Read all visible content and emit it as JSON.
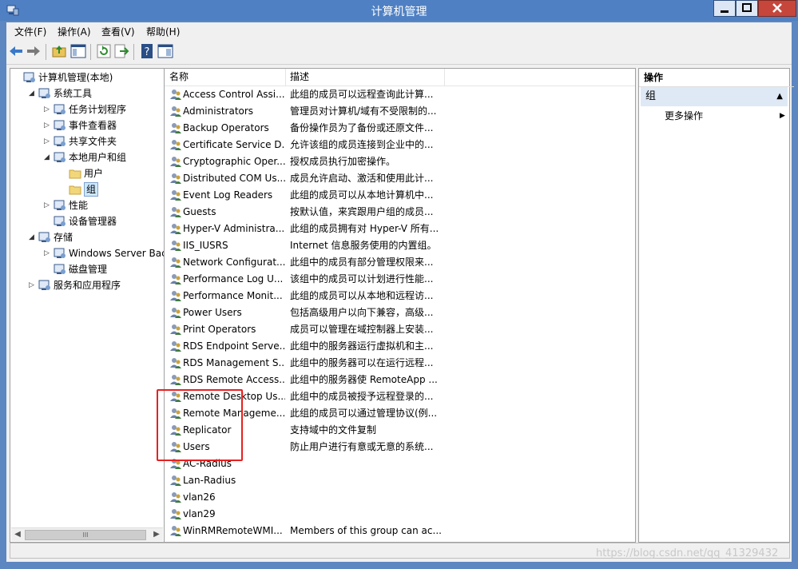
{
  "window": {
    "title": "计算机管理",
    "min_label": "minimize",
    "max_label": "maximize",
    "close_label": "close"
  },
  "menu": [
    "文件(F)",
    "操作(A)",
    "查看(V)",
    "帮助(H)"
  ],
  "toolbar": {
    "icons": [
      "back-arrow-icon",
      "forward-arrow-icon",
      "up-folder-icon",
      "show-hide-tree-icon",
      "refresh-icon",
      "export-list-icon",
      "help-icon",
      "show-action-pane-icon"
    ]
  },
  "tree": {
    "items": [
      {
        "label": "计算机管理(本地)",
        "icon": "computer-management-icon",
        "expander": ""
      },
      {
        "label": "系统工具",
        "icon": "system-tools-icon",
        "expander": "◢"
      },
      {
        "label": "任务计划程序",
        "icon": "clock-icon",
        "expander": "▷"
      },
      {
        "label": "事件查看器",
        "icon": "event-viewer-icon",
        "expander": "▷"
      },
      {
        "label": "共享文件夹",
        "icon": "shared-folder-icon",
        "expander": "▷"
      },
      {
        "label": "本地用户和组",
        "icon": "users-groups-icon",
        "expander": "◢"
      },
      {
        "label": "用户",
        "icon": "folder-icon",
        "expander": ""
      },
      {
        "label": "组",
        "icon": "folder-icon",
        "expander": ""
      },
      {
        "label": "性能",
        "icon": "performance-icon",
        "expander": "▷"
      },
      {
        "label": "设备管理器",
        "icon": "device-manager-icon",
        "expander": ""
      },
      {
        "label": "存储",
        "icon": "storage-icon",
        "expander": "◢"
      },
      {
        "label": "Windows Server Back",
        "icon": "backup-icon",
        "expander": "▷"
      },
      {
        "label": "磁盘管理",
        "icon": "disk-icon",
        "expander": ""
      },
      {
        "label": "服务和应用程序",
        "icon": "services-icon",
        "expander": "▷"
      }
    ],
    "scroll_thumb": "III"
  },
  "list": {
    "columns": [
      "名称",
      "描述"
    ],
    "rows": [
      {
        "name": "Access Control Assi...",
        "desc": "此组的成员可以远程查询此计算..."
      },
      {
        "name": "Administrators",
        "desc": "管理员对计算机/域有不受限制的..."
      },
      {
        "name": "Backup Operators",
        "desc": "备份操作员为了备份或还原文件..."
      },
      {
        "name": "Certificate Service D...",
        "desc": "允许该组的成员连接到企业中的..."
      },
      {
        "name": "Cryptographic Oper...",
        "desc": "授权成员执行加密操作。"
      },
      {
        "name": "Distributed COM Us...",
        "desc": "成员允许启动、激活和使用此计..."
      },
      {
        "name": "Event Log Readers",
        "desc": "此组的成员可以从本地计算机中..."
      },
      {
        "name": "Guests",
        "desc": "按默认值，来宾跟用户组的成员..."
      },
      {
        "name": "Hyper-V Administra...",
        "desc": "此组的成员拥有对 Hyper-V 所有..."
      },
      {
        "name": "IIS_IUSRS",
        "desc": "Internet 信息服务使用的内置组。"
      },
      {
        "name": "Network Configurat...",
        "desc": "此组中的成员有部分管理权限来..."
      },
      {
        "name": "Performance Log U...",
        "desc": "该组中的成员可以计划进行性能..."
      },
      {
        "name": "Performance Monit...",
        "desc": "此组的成员可以从本地和远程访..."
      },
      {
        "name": "Power Users",
        "desc": "包括高级用户以向下兼容，高级..."
      },
      {
        "name": "Print Operators",
        "desc": "成员可以管理在域控制器上安装..."
      },
      {
        "name": "RDS Endpoint Serve...",
        "desc": "此组中的服务器运行虚拟机和主..."
      },
      {
        "name": "RDS Management S...",
        "desc": "此组中的服务器可以在运行远程..."
      },
      {
        "name": "RDS Remote Access...",
        "desc": "此组中的服务器使 RemoteApp ..."
      },
      {
        "name": "Remote Desktop Us...",
        "desc": "此组中的成员被授予远程登录的..."
      },
      {
        "name": "Remote Manageme...",
        "desc": "此组的成员可以通过管理协议(例..."
      },
      {
        "name": "Replicator",
        "desc": "支持域中的文件复制"
      },
      {
        "name": "Users",
        "desc": "防止用户进行有意或无意的系统..."
      },
      {
        "name": "AC-Radius",
        "desc": ""
      },
      {
        "name": "Lan-Radius",
        "desc": ""
      },
      {
        "name": "vlan26",
        "desc": ""
      },
      {
        "name": "vlan29",
        "desc": ""
      },
      {
        "name": "WinRMRemoteWMI...",
        "desc": "Members of this group can ac..."
      }
    ]
  },
  "actions": {
    "header": "操作",
    "group_label": "组",
    "more": "更多操作"
  },
  "watermark": "https://blog.csdn.net/qq_41329432"
}
